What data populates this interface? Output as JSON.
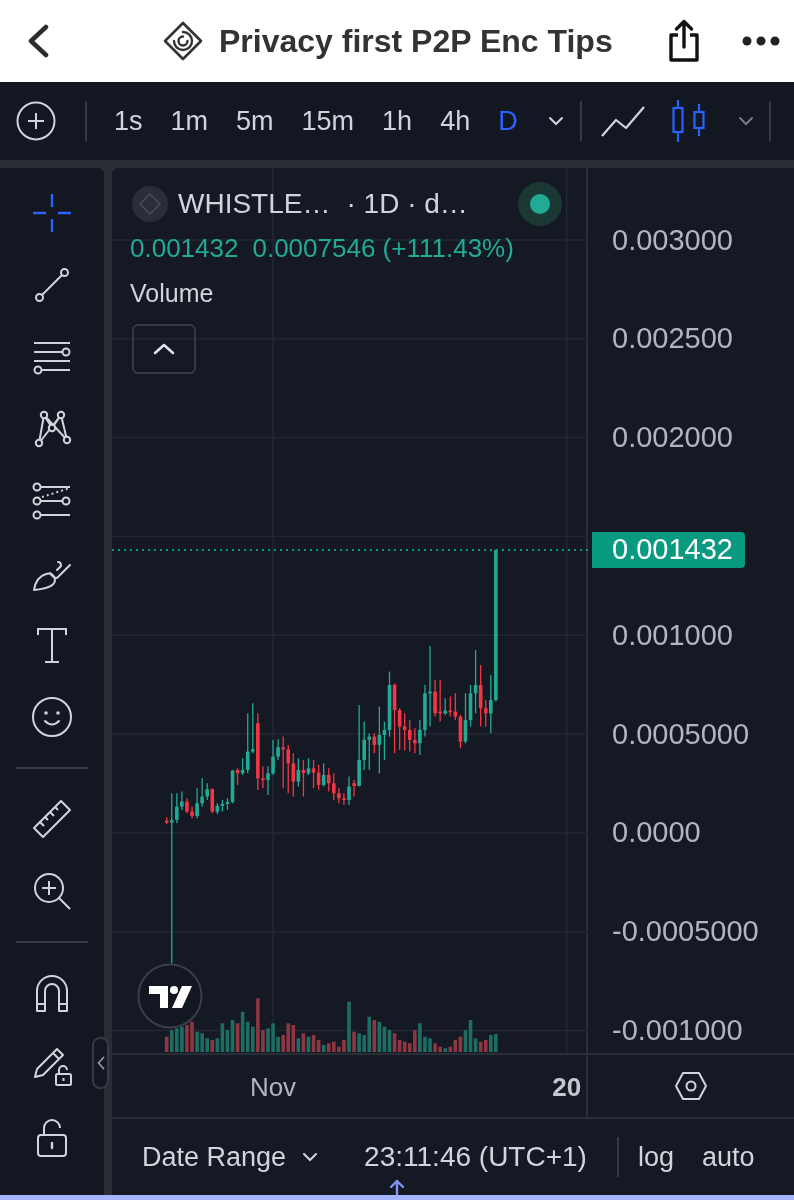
{
  "header": {
    "title": "Privacy first P2P Enc Tips"
  },
  "toolbar": {
    "intervals": [
      {
        "label": "1s",
        "selected": false
      },
      {
        "label": "1m",
        "selected": false
      },
      {
        "label": "5m",
        "selected": false
      },
      {
        "label": "15m",
        "selected": false
      },
      {
        "label": "1h",
        "selected": false
      },
      {
        "label": "4h",
        "selected": false
      },
      {
        "label": "D",
        "selected": true
      }
    ],
    "chart_types": [
      {
        "kind": "line",
        "selected": false
      },
      {
        "kind": "candles",
        "selected": true
      }
    ]
  },
  "drawing_tools": [
    {
      "tools": [
        {
          "kind": "crosshair",
          "selected": true
        },
        {
          "kind": "trend_line",
          "selected": false
        },
        {
          "kind": "fib",
          "selected": false
        },
        {
          "kind": "pattern",
          "selected": false
        },
        {
          "kind": "projection",
          "selected": false
        },
        {
          "kind": "brush",
          "selected": false
        },
        {
          "kind": "text",
          "selected": false
        },
        {
          "kind": "emoji",
          "selected": false
        }
      ]
    },
    {
      "tools": [
        {
          "kind": "ruler",
          "selected": false
        },
        {
          "kind": "zoom",
          "selected": false
        }
      ]
    },
    {
      "tools": [
        {
          "kind": "magnet",
          "selected": false
        },
        {
          "kind": "lock_drawings",
          "selected": false
        },
        {
          "kind": "lock",
          "selected": false
        }
      ]
    }
  ],
  "legend": {
    "symbol": "WHISTLE…",
    "details": "· 1D · d…",
    "live": true,
    "last": "0.001432",
    "change": "0.0007546 (+111.43%)",
    "indicator": "Volume"
  },
  "chart": {
    "time_labels_emphasized": [
      false,
      true
    ],
    "chart_data": {
      "type": "candlestick",
      "categories": [
        null,
        null,
        null,
        null,
        null,
        null,
        null,
        null,
        null,
        null,
        null,
        null,
        null,
        null,
        null,
        null,
        null,
        null,
        null,
        null,
        null,
        "Nov",
        null,
        null,
        null,
        null,
        null,
        null,
        null,
        null,
        null,
        null,
        null,
        null,
        null,
        null,
        null,
        null,
        null,
        null,
        null,
        null,
        null,
        null,
        null,
        null,
        null,
        null,
        null,
        null,
        null,
        null,
        null,
        null,
        null,
        null,
        null,
        null,
        null,
        null,
        null,
        null,
        null,
        null,
        null,
        null,
        null,
        null,
        null,
        null,
        null,
        null,
        null,
        null,
        null,
        null,
        null,
        null,
        null,
        "20"
      ],
      "ohlc": [
        [
          6.24e-05,
          7.93e-05,
          4.55e-05,
          5.23e-05
        ],
        [
          5.23e-05,
          0.0002007,
          -0.0006593,
          6.58e-05
        ],
        [
          6.58e-05,
          0.0002007,
          4.89e-05,
          0.0001332
        ],
        [
          0.0001332,
          0.0002091,
          0.0001164,
          0.0001585
        ],
        [
          0.0001585,
          0.0001754,
          9.95e-05,
          0.0001079
        ],
        [
          0.0001079,
          0.0001332,
          7.42e-05,
          8.6e-05
        ],
        [
          8.6e-05,
          0.000226,
          7.42e-05,
          0.0001501
        ],
        [
          0.0001501,
          0.0002766,
          0.0001332,
          0.0001838
        ],
        [
          0.0001838,
          0.0002513,
          0.0001669,
          0.0002209
        ],
        [
          0.0002209,
          0.000226,
          9.95e-05,
          0.0001079
        ],
        [
          0.0001079,
          0.0001501,
          9.61e-05,
          0.0001366
        ],
        [
          0.0001366,
          0.0001669,
          0.0001079,
          0.0001467
        ],
        [
          0.0001467,
          0.0001754,
          0.0001164,
          0.0001568
        ],
        [
          0.0001568,
          0.0003187,
          0.0001501,
          0.0003153
        ],
        [
          0.0003187,
          0.0003271,
          0.0002428,
          0.0003018
        ],
        [
          0.0003018,
          0.0003777,
          0.0002934,
          0.0003187
        ],
        [
          0.0003187,
          0.0006054,
          0.0003018,
          0.0004115
        ],
        [
          0.0004115,
          0.000656,
          0.000403,
          0.0004233
        ],
        [
          0.0005548,
          0.0006054,
          0.0002175,
          0.0002766
        ],
        [
          0.0002766,
          0.0003356,
          0.000226,
          0.0002681
        ],
        [
          0.0002681,
          0.0003356,
          0.0001922,
          0.0003018
        ],
        [
          0.0003018,
          0.0004705,
          0.0002934,
          0.0003862
        ],
        [
          0.0003862,
          0.0004739,
          0.0003693,
          0.0004334
        ],
        [
          0.0004334,
          0.0004873,
          0.000226,
          0.0004233
        ],
        [
          0.0004233,
          0.0004452,
          0.0002007,
          0.0003524
        ],
        [
          0.0003524,
          0.000403,
          0.0001838,
          0.0002597
        ],
        [
          0.0002597,
          0.0003777,
          0.0002344,
          0.0003187
        ],
        [
          0.0003187,
          0.0003693,
          0.0001838,
          0.0003018
        ],
        [
          0.0003018,
          0.0003777,
          0.0002934,
          0.0003271
        ],
        [
          0.0003271,
          0.0003693,
          0.000226,
          0.0003052
        ],
        [
          0.0003052,
          0.000344,
          0.0002175,
          0.0002428
        ],
        [
          0.0002428,
          0.0003524,
          0.0002344,
          0.0002934
        ],
        [
          0.0002934,
          0.0003271,
          0.0002091,
          0.0002513
        ],
        [
          0.0002513,
          0.0003018,
          0.0001669,
          0.0002007
        ],
        [
          0.0002007,
          0.000226,
          0.0001501,
          0.0001754
        ],
        [
          0.0001754,
          0.0002007,
          0.0001416,
          0.0001669
        ],
        [
          0.0001669,
          0.000285,
          0.0001416,
          0.0002344
        ],
        [
          0.0002513,
          0.0002681,
          0.0001838,
          0.0002378
        ],
        [
          0.0002378,
          0.0006475,
          0.0002344,
          0.0003693
        ],
        [
          0.0003693,
          0.0005632,
          0.0003187,
          0.0004705
        ],
        [
          0.0004705,
          0.0005042,
          0.0003187,
          0.0004873
        ],
        [
          0.0004873,
          0.0005042,
          0.000403,
          0.0004452
        ],
        [
          0.0004452,
          0.0006391,
          0.0003018,
          0.0004958
        ],
        [
          0.0004958,
          0.0005632,
          0.0003693,
          0.0005211
        ],
        [
          0.0005211,
          0.0008162,
          0.0004873,
          0.0007487
        ],
        [
          0.0007487,
          0.0007571,
          0.000403,
          0.0006222
        ],
        [
          0.0006222,
          0.0006307,
          0.0004199,
          0.0005379
        ],
        [
          0.0005379,
          0.0006054,
          0.0004165,
          0.0005211
        ],
        [
          0.0005211,
          0.0005717,
          0.0004115,
          0.0004705
        ],
        [
          0.0004705,
          0.0005295,
          0.000403,
          0.0004536
        ],
        [
          0.0004536,
          0.0005717,
          0.0003946,
          0.0005211
        ],
        [
          0.0005211,
          0.0007487,
          0.0004873,
          0.0007066
        ],
        [
          0.0007066,
          0.000946,
          0.0005379,
          0.000715
        ],
        [
          0.000715,
          0.000774,
          0.0005885,
          0.0006054
        ],
        [
          0.0006138,
          0.000774,
          0.0005632,
          0.0006054
        ],
        [
          0.0006054,
          0.0006813,
          0.000597,
          0.0006189
        ],
        [
          0.0006189,
          0.0006897,
          0.0005885,
          0.0006138
        ],
        [
          0.0006138,
          0.0007066,
          0.0005717,
          0.0005885
        ],
        [
          0.0005885,
          0.000597,
          0.0004283,
          0.000462
        ],
        [
          0.000462,
          0.0007066,
          0.0004536,
          0.0005717
        ],
        [
          0.0005717,
          0.0007487,
          0.0005379,
          0.0007066
        ],
        [
          0.0007066,
          0.0009258,
          0.0006054,
          0.0007487
        ],
        [
          0.0007487,
          0.0008499,
          0.0005379,
          0.0006307
        ],
        [
          0.0006307,
          0.0006728,
          0.0005379,
          0.0006054
        ],
        [
          0.0006054,
          0.0007993,
          0.0005042,
          0.0006728
        ],
        [
          0.0006728,
          0.001432,
          0.0006644,
          0.001432
        ],
        null,
        null,
        null,
        null,
        null,
        null,
        null,
        null,
        null,
        null,
        null,
        null,
        null,
        null
      ],
      "ylim": [
        -0.0011134,
        0.0033642
      ],
      "grid": true,
      "yticks": [
        {
          "value": 0.003,
          "label": "0.003000"
        },
        {
          "value": 0.0025,
          "label": "0.002500"
        },
        {
          "value": 0.002,
          "label": "0.002000"
        },
        {
          "value": 0.001,
          "label": "0.001000"
        },
        {
          "value": 0.0005,
          "label": "0.0005000"
        },
        {
          "value": 0,
          "label": "0.0000"
        },
        {
          "value": -0.0005,
          "label": "-0.0005000"
        },
        {
          "value": -0.001,
          "label": "-0.001000"
        }
      ],
      "ref_lines": [
        {
          "axis": "y",
          "value": 0.001432,
          "label": "0.001432",
          "color": "#089981"
        }
      ]
    }
  },
  "bottom_bar": {
    "date_range": "Date Range",
    "time": "23:11:46 (UTC+1)",
    "scale_options": [
      "log",
      "auto"
    ]
  }
}
